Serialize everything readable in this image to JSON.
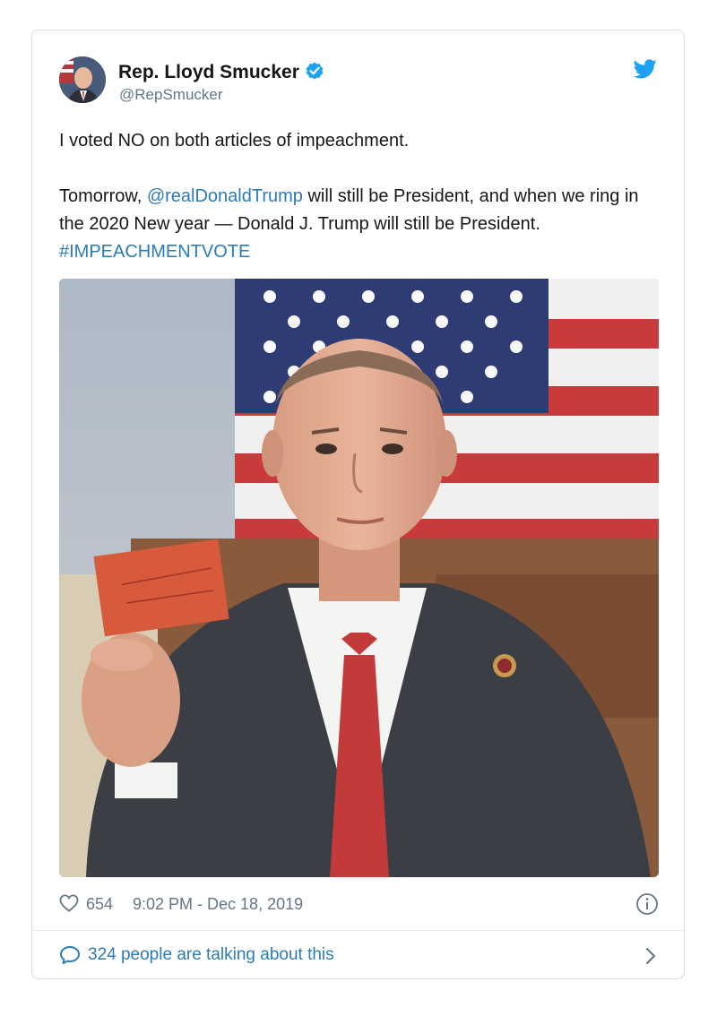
{
  "author": {
    "name": "Rep. Lloyd Smucker",
    "handle": "@RepSmucker"
  },
  "tweet": {
    "line1": "I voted NO on both articles of impeachment.",
    "p2_start": "Tomorrow, ",
    "mention": "@realDonaldTrump",
    "p2_mid": " will still be President, and when we ring in the 2020 New year — Donald J. Trump will still be President. ",
    "hashtag": "#IMPEACHMENTVOTE"
  },
  "meta": {
    "likes": "654",
    "timestamp": "9:02 PM - Dec 18, 2019"
  },
  "conversation": {
    "label": "324 people are talking about this"
  },
  "icons": {
    "brand": "twitter-bird-icon",
    "verified": "verified-badge-icon",
    "like": "heart-icon",
    "info": "info-icon",
    "reply": "speech-bubble-icon",
    "chevron": "chevron-right-icon"
  },
  "colors": {
    "link": "#2b7bb9",
    "brand": "#1da1f2",
    "muted": "#657786",
    "border": "#d9dde0"
  }
}
